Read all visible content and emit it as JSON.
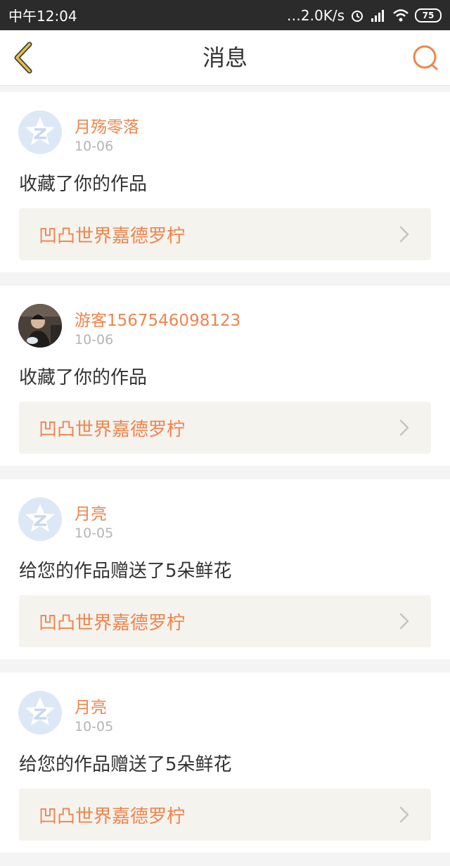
{
  "status_bar": {
    "time": "中午12:04",
    "network_speed": "…2.0K/s",
    "battery": "75",
    "icons": [
      "alarm-icon",
      "signal-hd-icon",
      "wifi-icon",
      "battery-icon"
    ]
  },
  "header": {
    "title": "消息",
    "icons": [
      "back-chevron-icon",
      "search-icon"
    ]
  },
  "colors": {
    "accent": "#f0844c",
    "back_icon": "#c9a42a",
    "work_bg": "#f4f3ee"
  },
  "messages": [
    {
      "username": "月殇零落",
      "date": "10-06",
      "action": "收藏了你的作品",
      "work_title": "凹凸世界嘉德罗柠",
      "avatar": "default-qzone-icon"
    },
    {
      "username": "游客1567546098123",
      "date": "10-06",
      "action": "收藏了你的作品",
      "work_title": "凹凸世界嘉德罗柠",
      "avatar": "user-photo"
    },
    {
      "username": "月亮",
      "date": "10-05",
      "action": "给您的作品赠送了5朵鲜花",
      "work_title": "凹凸世界嘉德罗柠",
      "avatar": "default-qzone-icon"
    },
    {
      "username": "月亮",
      "date": "10-05",
      "action": "给您的作品赠送了5朵鲜花",
      "work_title": "凹凸世界嘉德罗柠",
      "avatar": "default-qzone-icon"
    }
  ]
}
